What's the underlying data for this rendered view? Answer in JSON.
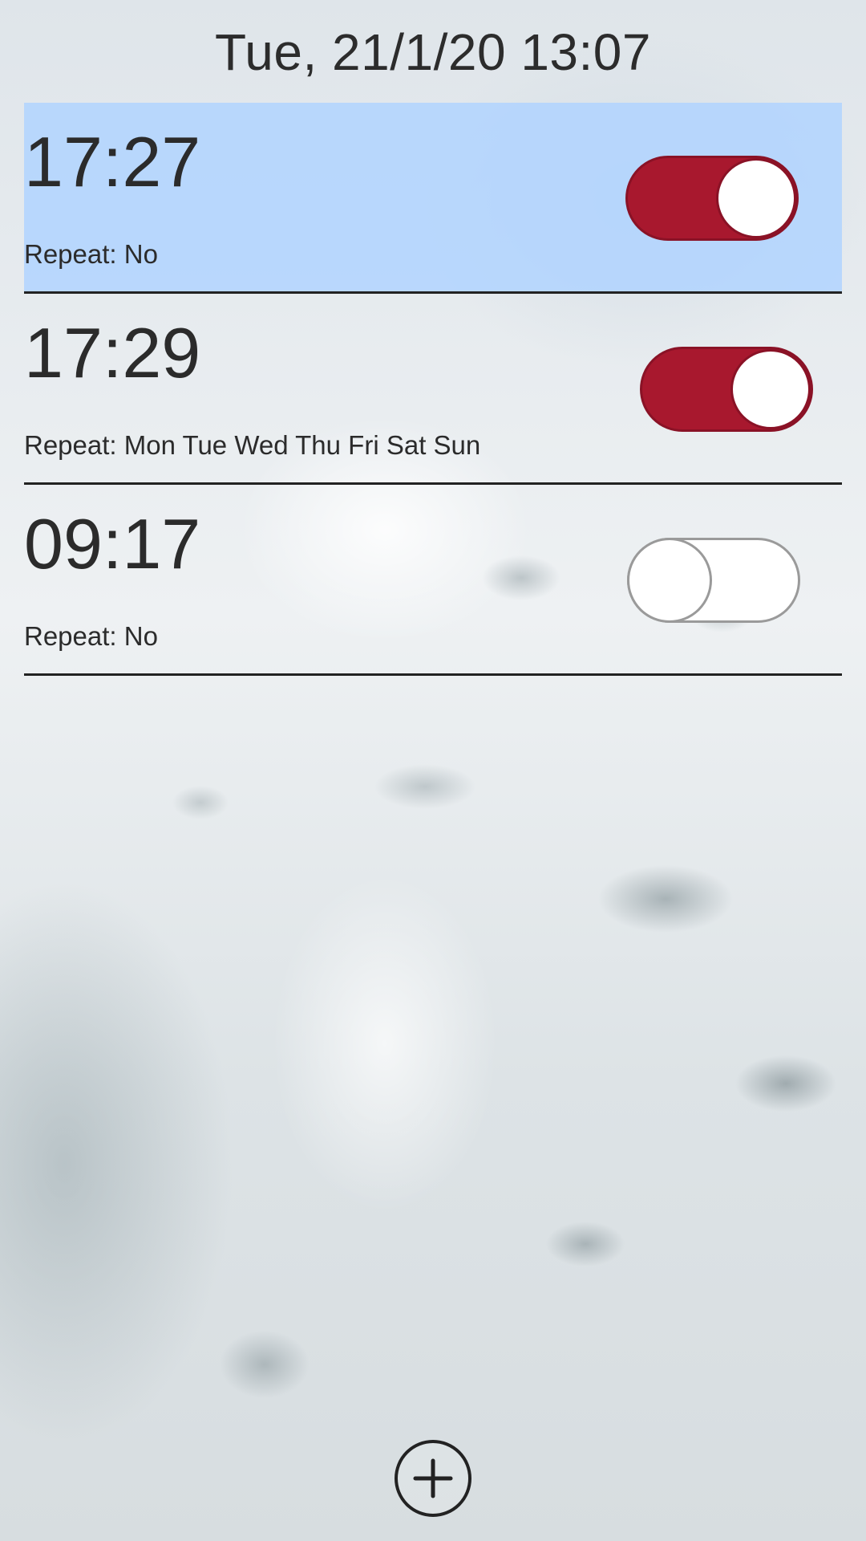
{
  "header": {
    "datetime": "Tue, 21/1/20 13:07"
  },
  "alarms": [
    {
      "time": "17:27",
      "repeat": "Repeat: No",
      "enabled": true,
      "selected": true
    },
    {
      "time": "17:29",
      "repeat": "Repeat: Mon Tue Wed Thu Fri Sat Sun",
      "enabled": true,
      "selected": false
    },
    {
      "time": "09:17",
      "repeat": "Repeat: No",
      "enabled": false,
      "selected": false
    }
  ],
  "add_button": {
    "icon": "plus-circle-icon"
  },
  "colors": {
    "toggle_on": "#a8182e",
    "selected_row": "#b0d4ff"
  }
}
